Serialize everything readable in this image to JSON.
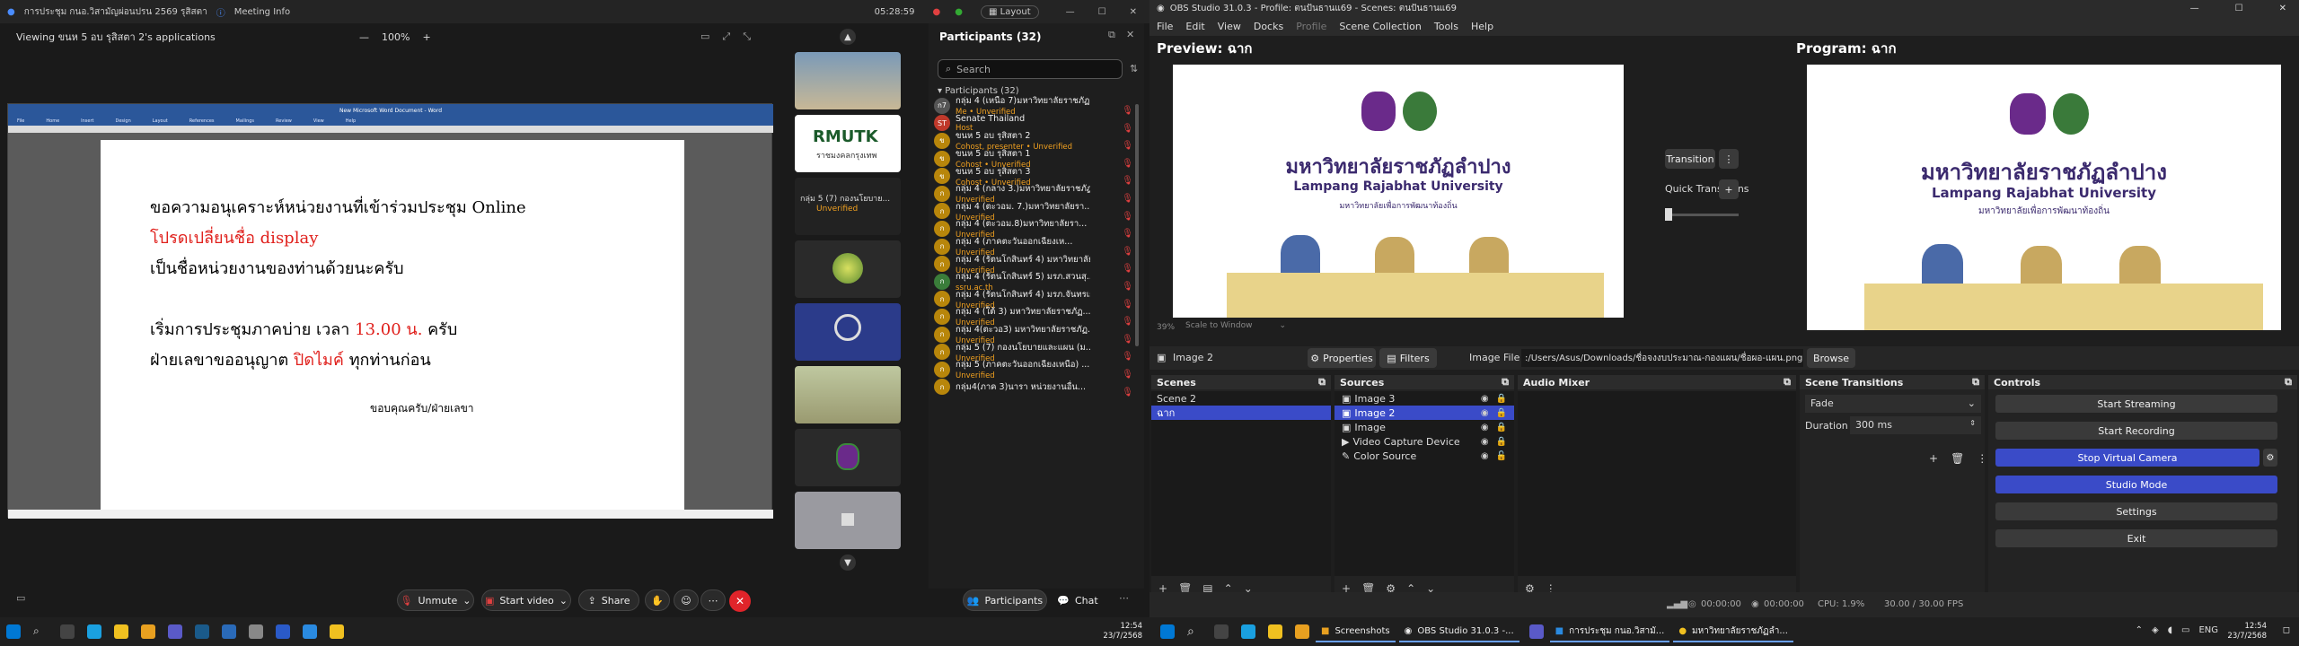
{
  "zoom": {
    "window_title": "การประชุม กนอ.วิสามัญผ่อนปรน 2569 รุสิสตา",
    "meeting_info": "Meeting Info",
    "clock": "05:28:59",
    "layout_label": "Layout",
    "viewing_label": "Viewing ขนห 5 อบ รุสิสตา 2's applications",
    "zoom_level": "100%",
    "word_title": "New Microsoft Word Document - Word",
    "word_tabs": [
      "File",
      "Home",
      "Insert",
      "Design",
      "Layout",
      "References",
      "Mailings",
      "Review",
      "View",
      "Help"
    ],
    "doc_lines": {
      "l1": "ขอความอนุเคราะห์หน่วยงานที่เข้าร่วมประชุม Online",
      "l2": "โปรดเปลี่ยนชื่อ display",
      "l3": "เป็นชื่อหน่วยงานของท่านด้วยนะครับ",
      "l4a": "เริ่มการประชุมภาคบ่าย เวลา ",
      "l4b": "13.00 น.",
      "l4c": " ครับ",
      "l5a": "ฝ่ายเลขาขออนุญาต ",
      "l5b": "ปิดไมค์",
      "l5c": " ทุกท่านก่อน",
      "sign": "ขอบคุณครับ/ฝ่ายเลขา"
    },
    "tile_labels": {
      "t2": "RMUTK",
      "t2sub": "ราชมงคลกรุงเทพ",
      "t3": "กลุ่ม 5 (7) กองนโยบาย...",
      "t3sub": "Unverified"
    },
    "participants": {
      "header": "Participants (32)",
      "search_placeholder": "Search",
      "group_label": "Participants (32)",
      "rows": [
        {
          "name": "กลุ่ม 4 (เหนือ 7)มหาวิทยาลัยราชภัฏ...",
          "sub": "Me • Unverified",
          "av": "ก7",
          "avc": "#555"
        },
        {
          "name": "Senate Thailand",
          "sub": "Host",
          "av": "ST",
          "avc": "#c0392b"
        },
        {
          "name": "ขนห 5 อบ รุสิสตา 2",
          "sub": "Cohost, presenter • Unverified",
          "av": "ข",
          "avc": "#b8860b"
        },
        {
          "name": "ขนห 5 อบ รุสิสตา 1",
          "sub": "Cohost • Unverified",
          "av": "ข",
          "avc": "#b8860b"
        },
        {
          "name": "ขนห 5 อบ รุสิสตา 3",
          "sub": "Cohost • Unverified",
          "av": "ข",
          "avc": "#b8860b"
        },
        {
          "name": "กลุ่ม 4 (กลาง 3.)มหาวิทยาลัยราชภัฏ...",
          "sub": "Unverified",
          "av": "ก",
          "avc": "#b8860b"
        },
        {
          "name": "กลุ่ม 4 (ตะวอม. 7.)มหาวิทยาลัยรา...",
          "sub": "Unverified",
          "av": "ก",
          "avc": "#b8860b"
        },
        {
          "name": "กลุ่ม 4 (ตะวอม.8)มหาวิทยาลัยรา...",
          "sub": "Unverified",
          "av": "ก",
          "avc": "#b8860b"
        },
        {
          "name": "กลุ่ม 4 (ภาคตะวันออกเฉียงเห...",
          "sub": "Unverified",
          "av": "ก",
          "avc": "#b8860b"
        },
        {
          "name": "กลุ่ม 4 (รัตนโกสินทร์ 4) มหาวิทยาลัย...",
          "sub": "Unverified",
          "av": "ก",
          "avc": "#b8860b"
        },
        {
          "name": "กลุ่ม 4 (รัตนโกสินทร์ 5) มรภ.สวนสุ...",
          "sub": "ssru.ac.th",
          "av": "ก",
          "avc": "#3a7d3a"
        },
        {
          "name": "กลุ่ม 4 (รัตนโกสินทร์ 4) มรภ.จันทรเก...",
          "sub": "Unverified",
          "av": "ก",
          "avc": "#b8860b"
        },
        {
          "name": "กลุ่ม 4 (ใต้ 3) มหาวิทยาลัยราชภัฏ...",
          "sub": "Unverified",
          "av": "ก",
          "avc": "#b8860b"
        },
        {
          "name": "กลุ่ม 4(ตะวอ3) มหาวิทยาลัยราชภัฏ...",
          "sub": "Unverified",
          "av": "ก",
          "avc": "#b8860b"
        },
        {
          "name": "กลุ่ม 5 (7) กองนโยบายและแผน (ม...",
          "sub": "Unverified",
          "av": "ก",
          "avc": "#b8860b"
        },
        {
          "name": "กลุ่ม 5 (ภาคตะวันออกเฉียงเหนือ) ...",
          "sub": "Unverified",
          "av": "ก",
          "avc": "#b8860b"
        },
        {
          "name": "กลุ่ม4(ภาค 3)นารา หน่วยงานอื่น...",
          "sub": "",
          "av": "ก",
          "avc": "#b8860b"
        }
      ]
    },
    "toolbar": {
      "unmute": "Unmute",
      "start_video": "Start video",
      "share": "Share",
      "participants": "Participants",
      "chat": "Chat"
    }
  },
  "obs": {
    "window_title": "OBS Studio 31.0.3 - Profile: ตนปันธานแ69 - Scenes: ตนปันธานแ69",
    "menu": [
      "File",
      "Edit",
      "View",
      "Docks",
      "Profile",
      "Scene Collection",
      "Tools",
      "Help"
    ],
    "preview_label": "Preview: ฉาก",
    "program_label": "Program: ฉาก",
    "stage": {
      "thai": "มหาวิทยาลัยราชภัฏลำปาง",
      "english": "Lampang Rajabhat University",
      "sub": "มหาวิทยาลัยเพื่อการพัฒนาท้องถิ่น"
    },
    "transition_label": "Transition",
    "quick_transitions": "Quick Transitions",
    "preview_zoom": "39%",
    "scale_mode": "Scale to Window",
    "source_toolbar": {
      "source_name": "Image 2",
      "properties": "Properties",
      "filters": "Filters",
      "image_file_label": "Image File",
      "image_path": ":/Users/Asus/Downloads/ชื่อจงงบประมาณ-กองแผน/ชื่อผอ-แผน.png",
      "browse": "Browse"
    },
    "scenes": {
      "title": "Scenes",
      "items": [
        "Scene 2",
        "ฉาก"
      ]
    },
    "sources": {
      "title": "Sources",
      "items": [
        "Image 3",
        "Image 2",
        "Image",
        "Video Capture Device",
        "Color Source"
      ]
    },
    "audio_mixer": {
      "title": "Audio Mixer"
    },
    "scene_transitions": {
      "title": "Scene Transitions",
      "type": "Fade",
      "duration_label": "Duration",
      "duration": "300 ms"
    },
    "controls": {
      "title": "Controls",
      "start_streaming": "Start Streaming",
      "start_recording": "Start Recording",
      "stop_virtual_camera": "Stop Virtual Camera",
      "studio_mode": "Studio Mode",
      "settings": "Settings",
      "exit": "Exit"
    },
    "status": {
      "stream_time": "00:00:00",
      "rec_time": "00:00:00",
      "cpu": "CPU: 1.9%",
      "fps": "30.00 / 30.00 FPS"
    }
  },
  "taskbar_left": {
    "time": "12:54",
    "date": "23/7/2568"
  },
  "taskbar_right": {
    "apps": [
      "Screenshots",
      "OBS Studio 31.0.3 -...",
      "การประชุม กนอ.วิสามั...",
      "มหาวิทยาลัยราชภัฏลำ..."
    ],
    "lang": "ENG",
    "time": "12:54",
    "date": "23/7/2568"
  }
}
